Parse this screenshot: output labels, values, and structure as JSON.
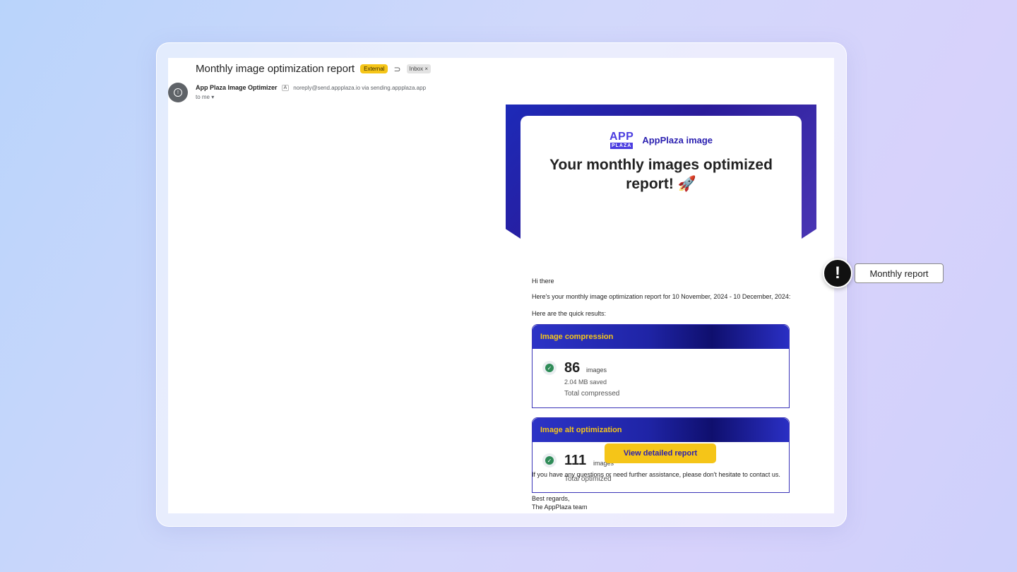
{
  "email": {
    "subject": "Monthly image optimization report",
    "external_badge": "External",
    "label_icon": "label-icon",
    "inbox_badge": "Inbox ×",
    "sender_name": "App Plaza Image Optimizer",
    "sender_email": "noreply@send.appplaza.io via sending.appplaza.app",
    "to_me": "to me ▾"
  },
  "report": {
    "logo_top": "APP",
    "logo_bottom": "PLAZA",
    "brand": "AppPlaza image",
    "headline": "Your monthly images optimized report! 🚀",
    "greeting": "Hi there",
    "intro": "Here's your monthly image optimization report for 10 November, 2024 - 10 December, 2024:",
    "quick": "Here are the quick results:",
    "compression": {
      "title": "Image compression",
      "count": "86",
      "unit": "images",
      "saved": "2.04 MB saved",
      "total_label": "Total compressed"
    },
    "alt": {
      "title": "Image alt optimization",
      "count": "111",
      "unit": "images",
      "total_label": "Total optimized"
    },
    "cta": "View detailed report",
    "questions": "If you have any questions or need further assistance, please don't hesitate to contact us.",
    "regards": "Best regards,",
    "team": "The AppPlaza team"
  },
  "tooltip": {
    "icon": "alert-icon",
    "label": "Monthly report"
  }
}
